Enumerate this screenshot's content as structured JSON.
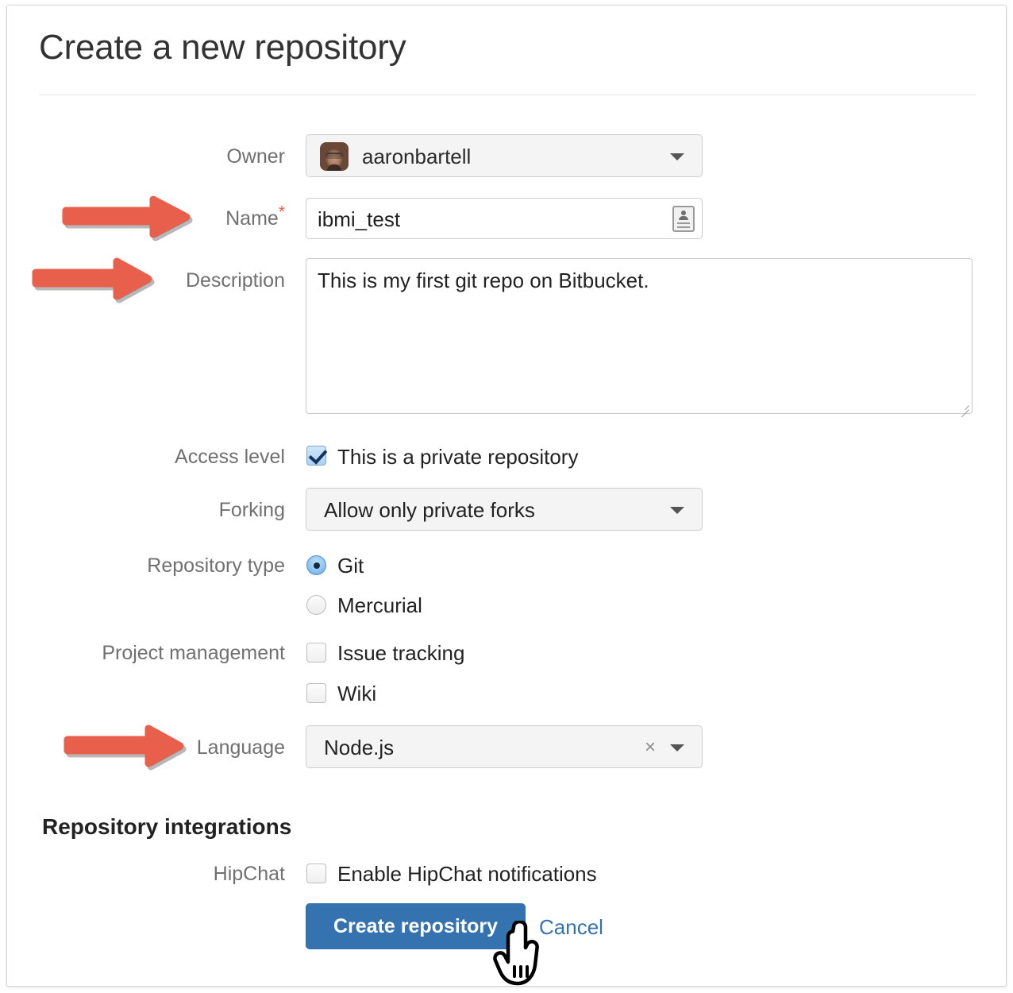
{
  "page": {
    "title": "Create a new repository"
  },
  "form": {
    "owner": {
      "label": "Owner",
      "value": "aaronbartell",
      "avatar_alt": "user-avatar"
    },
    "name": {
      "label": "Name",
      "required_marker": "*",
      "value": "ibmi_test",
      "placeholder": ""
    },
    "description": {
      "label": "Description",
      "value": "This is my first git repo on Bitbucket.",
      "placeholder": ""
    },
    "access_level": {
      "label": "Access level",
      "checkbox_label": "This is a private repository",
      "checked": true
    },
    "forking": {
      "label": "Forking",
      "value": "Allow only private forks",
      "options": [
        "Allow only private forks"
      ]
    },
    "repository_type": {
      "label": "Repository type",
      "options": [
        {
          "label": "Git",
          "selected": true
        },
        {
          "label": "Mercurial",
          "selected": false
        }
      ]
    },
    "project_management": {
      "label": "Project management",
      "options": [
        {
          "label": "Issue tracking",
          "checked": false
        },
        {
          "label": "Wiki",
          "checked": false
        }
      ]
    },
    "language": {
      "label": "Language",
      "value": "Node.js",
      "clear_glyph": "×",
      "options": [
        "Node.js"
      ]
    }
  },
  "integrations": {
    "heading": "Repository integrations",
    "hipchat": {
      "label": "HipChat",
      "checkbox_label": "Enable HipChat notifications",
      "checked": false
    }
  },
  "actions": {
    "submit_label": "Create repository",
    "cancel_label": "Cancel"
  },
  "annotations": {
    "arrow_color": "#e8604c",
    "targets": [
      "Name",
      "Description",
      "Language"
    ]
  },
  "colors": {
    "primary_button": "#3572b0",
    "link": "#3572b0",
    "label_text": "#707070",
    "body_text": "#222222",
    "required_star": "#e8604c",
    "field_fill": "#f4f4f4",
    "border": "#cfcfcf"
  }
}
